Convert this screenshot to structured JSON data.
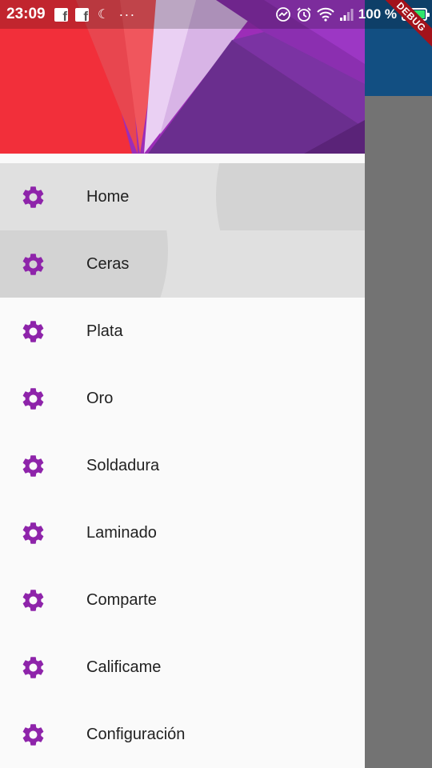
{
  "status_bar": {
    "time": "23:09",
    "left_icons": [
      "facebook-icon",
      "facebook-icon",
      "moon-icon",
      "more-dots-icon"
    ],
    "more_dots": "···",
    "right_icons": [
      "messenger-icon",
      "alarm-icon",
      "wifi-icon",
      "signal-icon",
      "battery-icon"
    ],
    "battery_percent": "100 %",
    "battery_level": 1.0,
    "battery_color": "#2ee66c"
  },
  "debug_banner": {
    "label": "DEBUG"
  },
  "drawer": {
    "selected_index": 0,
    "items": [
      {
        "label": "Home",
        "icon": "gear-icon"
      },
      {
        "label": "Ceras",
        "icon": "gear-icon"
      },
      {
        "label": "Plata",
        "icon": "gear-icon"
      },
      {
        "label": "Oro",
        "icon": "gear-icon"
      },
      {
        "label": "Soldadura",
        "icon": "gear-icon"
      },
      {
        "label": "Laminado",
        "icon": "gear-icon"
      },
      {
        "label": "Comparte",
        "icon": "gear-icon"
      },
      {
        "label": "Calificame",
        "icon": "gear-icon"
      },
      {
        "label": "Configuración",
        "icon": "gear-icon"
      }
    ]
  },
  "colors": {
    "accent": "#8e24aa",
    "appbar": "#124f82",
    "scrim": "#737373",
    "drawer_bg": "#fafafa",
    "selected_bg": "#e0e0e0",
    "text": "#212121",
    "debug": "#a3121b"
  }
}
